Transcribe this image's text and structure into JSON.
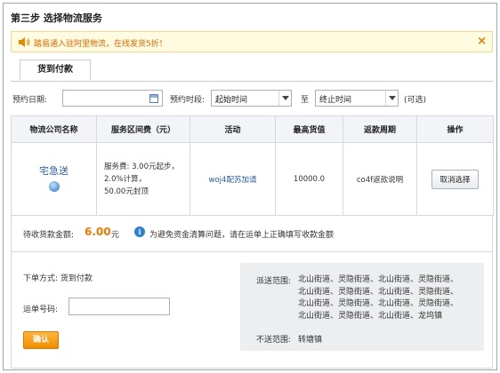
{
  "page": {
    "title": "第三步 选择物流服务"
  },
  "notice": {
    "text": "踏易通入驻阿里物流，在线发货5折！",
    "close": "×"
  },
  "tab": {
    "label": "货到付款"
  },
  "filter": {
    "date_label": "预约日期:",
    "period_label": "预约时段:",
    "start_select": "起始时间",
    "to_label": "至",
    "end_select": "终止时间",
    "optional": "(可选)"
  },
  "table": {
    "headers": [
      "物流公司名称",
      "服务区间费（元）",
      "活动",
      "最高货值",
      "返款周期",
      "操作"
    ],
    "rows": [
      {
        "company": "宅急送",
        "fee_lines": [
          "服务费: 3.00元起步，",
          "2.0%计算，",
          "50.00元封顶"
        ],
        "activity": "woj4配苏加请",
        "max_value": "10000.0",
        "refund_cycle": "co4f返款说明",
        "action": "取消选择"
      }
    ]
  },
  "amount": {
    "label": "待收货款金额:",
    "value": "6.00",
    "unit": "元",
    "info": "为避免资金清算问题，请在运单上正确填写收款金额"
  },
  "order": {
    "mode": "下单方式: 货到付款",
    "waybill_label": "运单号码:",
    "waybill_value": "",
    "confirm": "确认"
  },
  "range": {
    "label": "派送范围:",
    "lines": [
      "北山街道、灵隐街道、北山街道、灵隐街道、",
      "北山街道、灵隐街道、北山街道、灵隐街道、",
      "北山街道、灵隐街道、北山街道、灵隐街道、",
      "北山街道、灵隐街道、北山街道、龙坞镇"
    ],
    "no_label": "不送范围:",
    "no_value": "转塘镇"
  }
}
